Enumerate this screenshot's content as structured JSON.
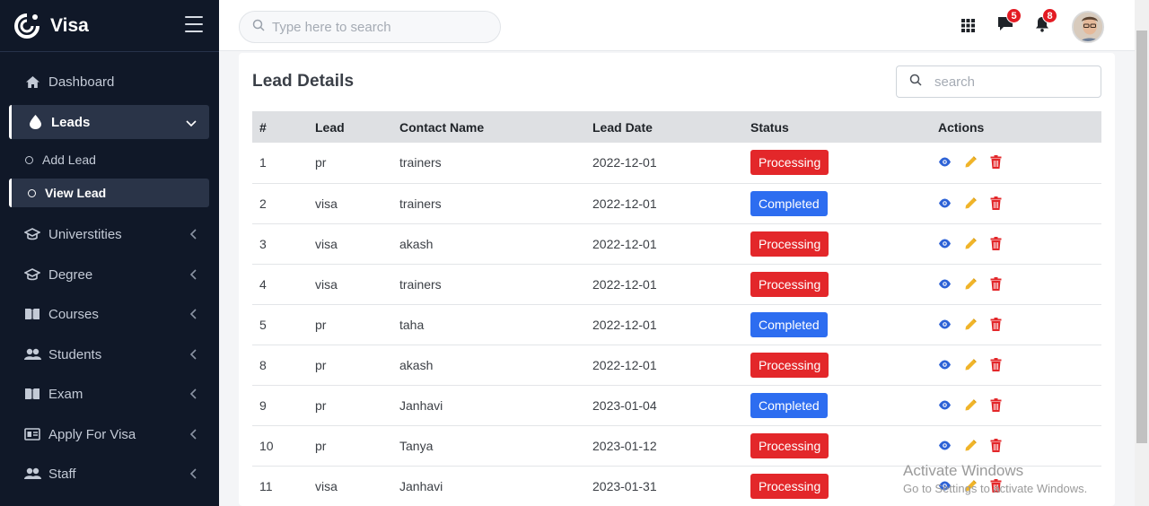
{
  "brand": {
    "name": "Visa"
  },
  "sidebar": {
    "items": [
      {
        "label": "Dashboard",
        "icon": "home-icon"
      },
      {
        "label": "Leads",
        "icon": "drop-icon"
      },
      {
        "label": "Add Lead"
      },
      {
        "label": "View Lead"
      },
      {
        "label": "Universtities",
        "icon": "graduation-cap-icon"
      },
      {
        "label": "Degree",
        "icon": "graduation-cap-icon"
      },
      {
        "label": "Courses",
        "icon": "book-icon"
      },
      {
        "label": "Students",
        "icon": "users-icon"
      },
      {
        "label": "Exam",
        "icon": "book-icon"
      },
      {
        "label": "Apply For Visa",
        "icon": "id-card-icon"
      },
      {
        "label": "Staff",
        "icon": "users-icon"
      }
    ]
  },
  "topbar": {
    "search_placeholder": "Type here to search",
    "messages_count": "5",
    "notifications_count": "8"
  },
  "content": {
    "title": "Lead Details",
    "search_placeholder": "search",
    "columns": [
      "#",
      "Lead",
      "Contact Name",
      "Lead Date",
      "Status",
      "Actions"
    ],
    "rows": [
      {
        "id": "1",
        "lead": "pr",
        "contact": "trainers",
        "date": "2022-12-01",
        "status": "Processing"
      },
      {
        "id": "2",
        "lead": "visa",
        "contact": "trainers",
        "date": "2022-12-01",
        "status": "Completed"
      },
      {
        "id": "3",
        "lead": "visa",
        "contact": "akash",
        "date": "2022-12-01",
        "status": "Processing"
      },
      {
        "id": "4",
        "lead": "visa",
        "contact": "trainers",
        "date": "2022-12-01",
        "status": "Processing"
      },
      {
        "id": "5",
        "lead": "pr",
        "contact": "taha",
        "date": "2022-12-01",
        "status": "Completed"
      },
      {
        "id": "8",
        "lead": "pr",
        "contact": "akash",
        "date": "2022-12-01",
        "status": "Processing"
      },
      {
        "id": "9",
        "lead": "pr",
        "contact": "Janhavi",
        "date": "2023-01-04",
        "status": "Completed"
      },
      {
        "id": "10",
        "lead": "pr",
        "contact": "Tanya",
        "date": "2023-01-12",
        "status": "Processing"
      },
      {
        "id": "11",
        "lead": "visa",
        "contact": "Janhavi",
        "date": "2023-01-31",
        "status": "Processing"
      }
    ]
  },
  "colors": {
    "sidebar_bg": "#101828",
    "processing": "#e3272a",
    "completed": "#2d6df0",
    "view_icon": "#2d62d6",
    "edit_icon": "#f0b429",
    "delete_icon": "#e3272a"
  },
  "watermark": {
    "line1": "Activate Windows",
    "line2": "Go to Settings to activate Windows."
  }
}
